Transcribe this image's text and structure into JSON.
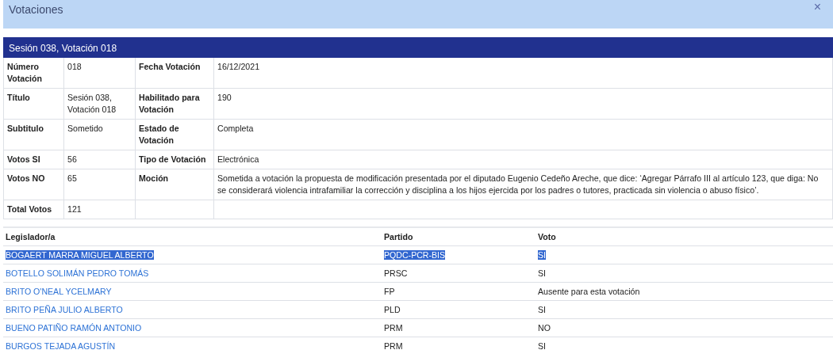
{
  "modal": {
    "title": "Votaciones",
    "close": "×"
  },
  "vote": {
    "heading": "Sesión 038, Votación 018",
    "details": [
      {
        "label": "Número Votación",
        "value": "018",
        "label_2": "Fecha Votación",
        "value_2": "16/12/2021"
      },
      {
        "label": "Título",
        "value": "Sesión 038, Votación 018",
        "label_2": "Habilitado para Votación",
        "value_2": "190"
      },
      {
        "label": "Subtitulo",
        "value": "Sometido",
        "label_2": "Estado de Votación",
        "value_2": "Completa"
      },
      {
        "label": "Votos SI",
        "value": "56",
        "label_2": "Tipo de Votación",
        "value_2": "Electrónica"
      },
      {
        "label": "Votos NO",
        "value": "65",
        "label_2": "Moción",
        "value_2": "Sometida a votación la propuesta de modificación presentada por el diputado Eugenio Cedeño Areche, que dice: ‘Agregar Párrafo III al artículo 123, que diga: No se considerará violencia intrafamiliar la corrección y disciplina a los hijos ejercida por los padres o tutores, practicada sin violencia o abuso físico’."
      },
      {
        "label": "Total Votos",
        "value": "121"
      }
    ]
  },
  "legislators": {
    "columns": [
      "Legislador/a",
      "Partido",
      "Voto"
    ],
    "rows": [
      {
        "name": "BOGAERT MARRA MIGUEL ALBERTO",
        "party": "PQDC-PCR-BIS",
        "vote": "SI",
        "selected": true
      },
      {
        "name": "BOTELLO SOLIMÁN PEDRO TOMÁS",
        "party": "PRSC",
        "vote": "SI",
        "selected": false
      },
      {
        "name": "BRITO O'NEAL YCELMARY",
        "party": "FP",
        "vote": "Ausente para esta votación",
        "selected": false
      },
      {
        "name": "BRITO PEÑA JULIO ALBERTO",
        "party": "PLD",
        "vote": "SI",
        "selected": false
      },
      {
        "name": "BUENO PATIÑO RAMÓN ANTONIO",
        "party": "PRM",
        "vote": "NO",
        "selected": false
      },
      {
        "name": "BURGOS TEJADA AGUSTÍN",
        "party": "PRM",
        "vote": "SI",
        "selected": false
      }
    ]
  }
}
